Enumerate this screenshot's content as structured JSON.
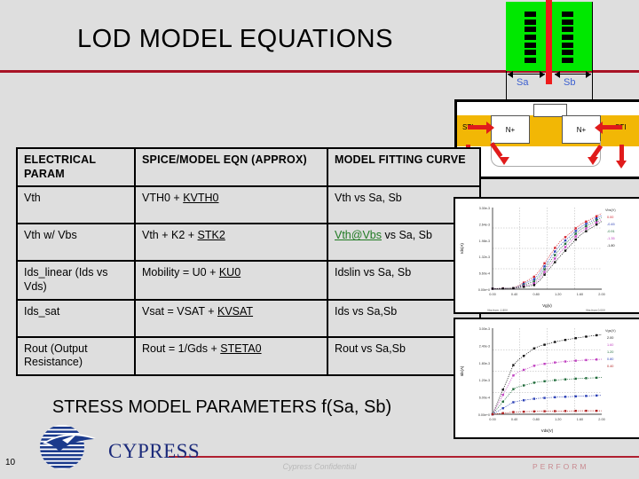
{
  "slide": {
    "title": "LOD MODEL EQUATIONS",
    "subtitle": "STRESS MODEL PARAMETERS f(Sa, Sb)",
    "number": "10",
    "confidential": "Cypress Confidential",
    "tagline": "PERFORM",
    "brand": "CYPRESS",
    "accent_color": "#a81326",
    "link_color": "#1f7a22",
    "background_color": "#dedede"
  },
  "table": {
    "headers": [
      "ELECTRICAL PARAM",
      "SPICE/MODEL EQN (APPROX)",
      "MODEL FITTING CURVE"
    ],
    "rows": [
      {
        "param": "Vth",
        "eqn_prefix": "VTH0 + ",
        "eqn_param": "KVTH0",
        "curve_link": "",
        "curve": "Vth vs Sa, Sb"
      },
      {
        "param": "Vth w/ Vbs",
        "eqn_prefix": "Vth + K2 + ",
        "eqn_param": "STK2",
        "curve_link": "Vth@Vbs",
        "curve": " vs Sa, Sb"
      },
      {
        "param": "Ids_linear (Ids vs Vds)",
        "eqn_prefix": "Mobility = U0 + ",
        "eqn_param": "KU0",
        "curve_link": "",
        "curve": "Idslin vs Sa, Sb"
      },
      {
        "param": "Ids_sat",
        "eqn_prefix": "Vsat = VSAT + ",
        "eqn_param": "KVSAT",
        "curve_link": "",
        "curve": "Ids vs Sa,Sb"
      },
      {
        "param": "Rout (Output Resistance)",
        "eqn_prefix": "Rout = 1/Gds + ",
        "eqn_param": "STETA0",
        "curve_link": "",
        "curve": "Rout vs Sa,Sb"
      }
    ]
  },
  "layout_figure": {
    "sa_label": "Sa",
    "sb_label": "Sb",
    "active_color": "#00e800",
    "gate_color": "#ee1b1b",
    "label_color": "#3b5fd0",
    "contact_rows": 7
  },
  "cross_section": {
    "sti_left_label": "STI",
    "sti_right_label": "STI",
    "nplus_left_label": "N+",
    "nplus_right_label": "N+",
    "sti_color": "#f2b705",
    "arrow_color": "#e01b1b"
  },
  "chart_data": [
    {
      "type": "line",
      "title": "",
      "xlabel": "Vg(v)",
      "ylabel": "Ids(A)",
      "x": [
        0.0,
        0.4,
        0.8,
        1.2,
        1.6,
        2.0
      ],
      "xlim": [
        0.0,
        2.0
      ],
      "ylim": [
        0,
        3.2
      ],
      "xticks": [
        "0.00",
        "0.40",
        "0.80",
        "1.20",
        "1.60",
        "2.00"
      ],
      "yticks": [
        "0.00e+0",
        "6.60e-4",
        "1.32e-3",
        "1.98e-3",
        "2.64e-3",
        "3.30e-3"
      ],
      "legend_title": "Vbs(V)",
      "legend_position": "right",
      "grid": true,
      "footnote_left": "Vbs from -1.80V",
      "footnote_right": "Vbs from 0.00V",
      "series": [
        {
          "name": "0.00",
          "color": "#d2222d",
          "values": [
            0.02,
            0.05,
            0.55,
            1.85,
            2.6,
            3.05
          ]
        },
        {
          "name": "-0.45",
          "color": "#2a3fb5",
          "values": [
            0.02,
            0.04,
            0.44,
            1.7,
            2.5,
            2.97
          ]
        },
        {
          "name": "-0.91",
          "color": "#1f6b3a",
          "values": [
            0.02,
            0.04,
            0.34,
            1.55,
            2.4,
            2.9
          ]
        },
        {
          "name": "-1.35",
          "color": "#c040c0",
          "values": [
            0.02,
            0.03,
            0.26,
            1.4,
            2.3,
            2.82
          ]
        },
        {
          "name": "-1.80",
          "color": "#111111",
          "values": [
            0.02,
            0.03,
            0.18,
            1.24,
            2.18,
            2.74
          ]
        }
      ]
    },
    {
      "type": "line",
      "title": "",
      "xlabel": "Vds(V)",
      "ylabel": "Ids(A)",
      "x": [
        0.0,
        0.4,
        0.8,
        1.2,
        1.6,
        2.0
      ],
      "xlim": [
        0.0,
        2.0
      ],
      "ylim": [
        0,
        0.003
      ],
      "xticks": [
        "0.00",
        "0.40",
        "0.80",
        "1.20",
        "1.60",
        "2.00"
      ],
      "yticks": [
        "0.00e+0",
        "6.00e-4",
        "1.20e-3",
        "1.80e-3",
        "2.40e-3",
        "3.00e-3"
      ],
      "legend_title": "Vgs(V)",
      "legend_position": "right",
      "grid": true,
      "series": [
        {
          "name": "2.00",
          "color": "#111111",
          "values": [
            0.0,
            1.8,
            2.35,
            2.55,
            2.68,
            2.78
          ]
        },
        {
          "name": "1.60",
          "color": "#c040c0",
          "values": [
            0.0,
            1.42,
            1.72,
            1.82,
            1.88,
            1.92
          ]
        },
        {
          "name": "1.20",
          "color": "#1f6b3a",
          "values": [
            0.0,
            0.92,
            1.12,
            1.2,
            1.25,
            1.28
          ]
        },
        {
          "name": "0.80",
          "color": "#2a3fb5",
          "values": [
            0.0,
            0.44,
            0.55,
            0.6,
            0.63,
            0.66
          ]
        },
        {
          "name": "0.40",
          "color": "#b01f1f",
          "values": [
            0.0,
            0.08,
            0.1,
            0.11,
            0.12,
            0.12
          ]
        }
      ]
    }
  ]
}
